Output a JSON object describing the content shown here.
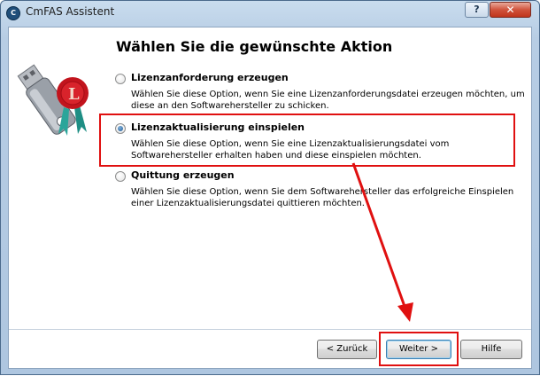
{
  "window": {
    "title": "CmFAS Assistent",
    "help_label": "?",
    "close_label": "✕"
  },
  "heading": "Wählen Sie die gewünschte Aktion",
  "options": [
    {
      "label": "Lizenzanforderung erzeugen",
      "description": "Wählen Sie diese Option, wenn Sie eine Lizenzanforderungsdatei erzeugen möchten, um diese an den Softwarehersteller zu schicken.",
      "selected": false
    },
    {
      "label": "Lizenzaktualisierung einspielen",
      "description": "Wählen Sie diese Option, wenn Sie eine Lizenzaktualisierungsdatei vom Softwarehersteller erhalten haben und diese einspielen möchten.",
      "selected": true
    },
    {
      "label": "Quittung erzeugen",
      "description": "Wählen Sie diese Option, wenn Sie dem Softwarehersteller das erfolgreiche Einspielen einer Lizenzaktualisierungsdatei quittieren möchten.",
      "selected": false
    }
  ],
  "buttons": {
    "back": "< Zurück",
    "next": "Weiter >",
    "help": "Hilfe"
  },
  "colors": {
    "annotation": "#e01010",
    "selection_dot": "#1f5a94"
  },
  "icons": {
    "app": "cmfas-app-icon",
    "logo": "usb-dongle-wax-seal-logo"
  }
}
